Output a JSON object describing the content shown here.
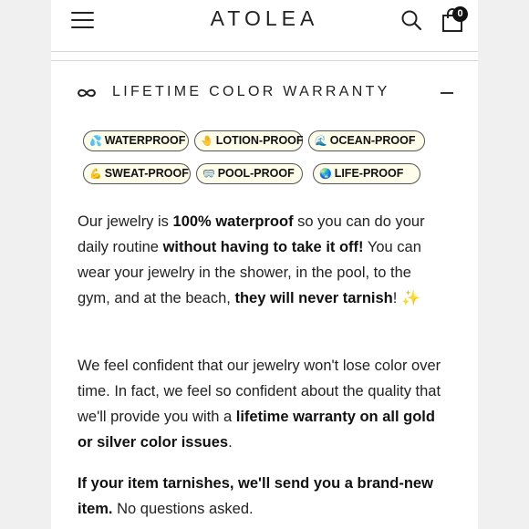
{
  "header": {
    "logo": "ATOLEA",
    "cart_count": "0"
  },
  "accordion": {
    "title": "LIFETIME COLOR WARRANTY"
  },
  "badges": [
    {
      "emoji": "💦",
      "label": "WATERPROOF"
    },
    {
      "emoji": "🤚",
      "label": "LOTION-PROOF"
    },
    {
      "emoji": "🌊",
      "label": "OCEAN-PROOF"
    },
    {
      "emoji": "💪",
      "label": "SWEAT-PROOF"
    },
    {
      "emoji": "🥽",
      "label": "POOL-PROOF"
    },
    {
      "emoji": "🌏",
      "label": "LIFE-PROOF"
    }
  ],
  "paragraph1": {
    "s1": "Our jewelry is ",
    "b1": "100% waterproof",
    "s2": " so you can do your daily routine ",
    "b2": "without having to take it off!",
    "s3": " You can wear your jewelry in the shower, in the pool, to the gym, and at the beach, ",
    "b3": "they will never tarnish",
    "s4": "! ",
    "sparkle": "✨"
  },
  "paragraph2": {
    "s1": "We feel confident that our jewelry won't lose color over time. In fact, we feel so confident about the quality that we'll provide you with a ",
    "b1": "lifetime warranty on all gold or silver color issues",
    "s2": "."
  },
  "paragraph3": {
    "b1": "If your item tarnishes, we'll send you a brand-new item.",
    "s1": " No questions asked."
  }
}
